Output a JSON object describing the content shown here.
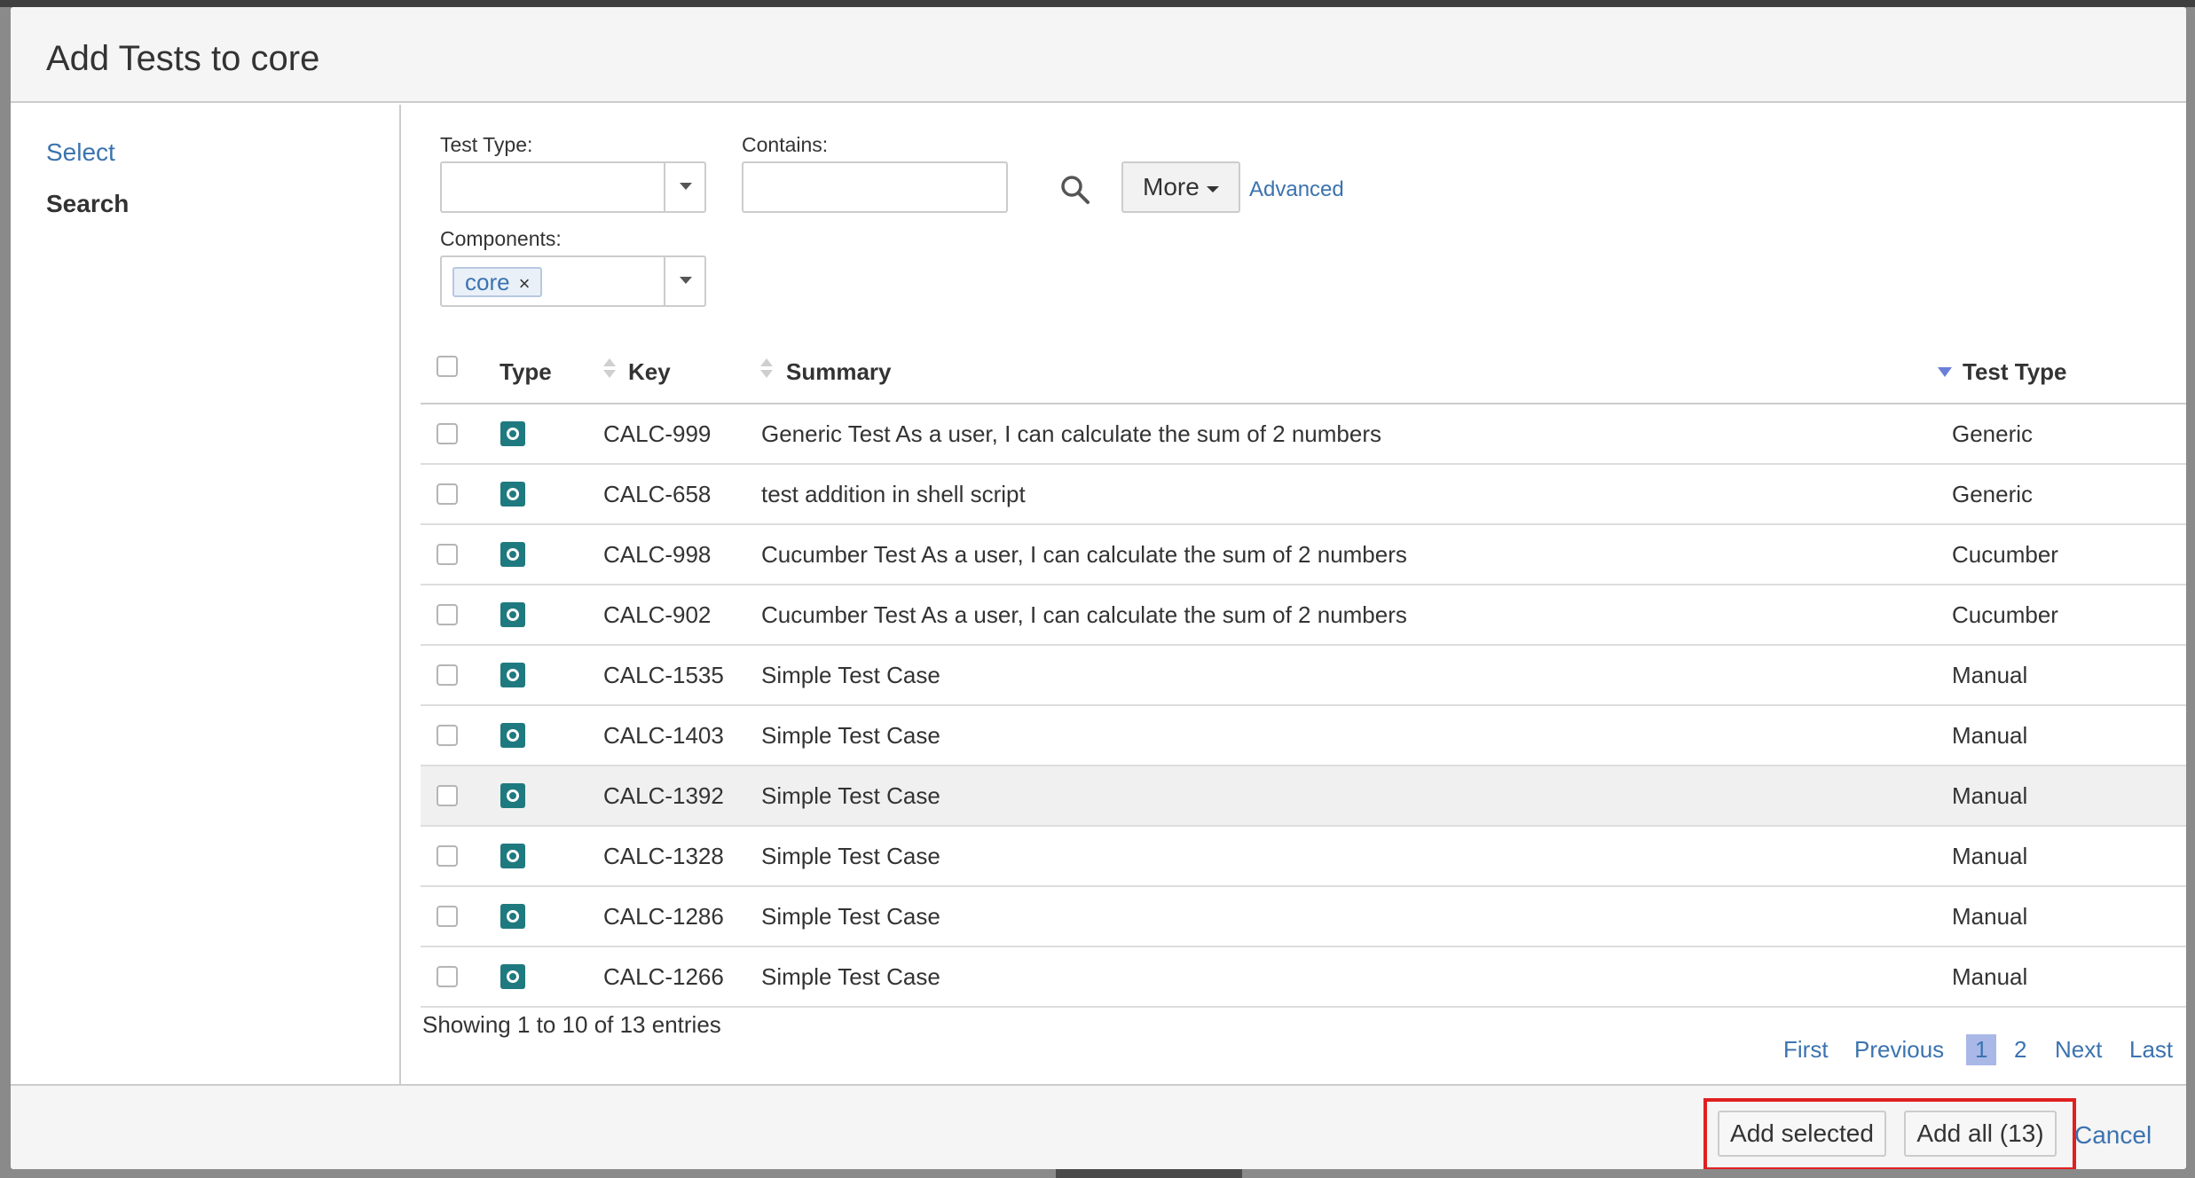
{
  "dialog": {
    "title": "Add Tests to core"
  },
  "sidebar": {
    "items": [
      {
        "label": "Select",
        "active": false
      },
      {
        "label": "Search",
        "active": true
      }
    ]
  },
  "filters": {
    "test_type_label": "Test Type:",
    "test_type_value": "",
    "contains_label": "Contains:",
    "contains_value": "",
    "components_label": "Components:",
    "component_tag": "core",
    "component_tag_remove": "×",
    "more_label": "More",
    "advanced_label": "Advanced",
    "search_icon": "search-icon"
  },
  "table": {
    "columns": [
      "Type",
      "Key",
      "Summary",
      "Test Type"
    ],
    "sorted_column": "Test Type",
    "rows": [
      {
        "key": "CALC-999",
        "summary": "Generic Test As a user, I can calculate the sum of 2 numbers",
        "test_type": "Generic"
      },
      {
        "key": "CALC-658",
        "summary": "test addition in shell script",
        "test_type": "Generic"
      },
      {
        "key": "CALC-998",
        "summary": "Cucumber Test As a user, I can calculate the sum of 2 numbers",
        "test_type": "Cucumber"
      },
      {
        "key": "CALC-902",
        "summary": "Cucumber Test As a user, I can calculate the sum of 2 numbers",
        "test_type": "Cucumber"
      },
      {
        "key": "CALC-1535",
        "summary": "Simple Test Case",
        "test_type": "Manual"
      },
      {
        "key": "CALC-1403",
        "summary": "Simple Test Case",
        "test_type": "Manual"
      },
      {
        "key": "CALC-1392",
        "summary": "Simple Test Case",
        "test_type": "Manual"
      },
      {
        "key": "CALC-1328",
        "summary": "Simple Test Case",
        "test_type": "Manual"
      },
      {
        "key": "CALC-1286",
        "summary": "Simple Test Case",
        "test_type": "Manual"
      },
      {
        "key": "CALC-1266",
        "summary": "Simple Test Case",
        "test_type": "Manual"
      }
    ]
  },
  "pagination": {
    "showing": "Showing 1 to 10 of 13 entries",
    "first": "First",
    "previous": "Previous",
    "pages": [
      "1",
      "2"
    ],
    "current_page": "1",
    "next": "Next",
    "last": "Last"
  },
  "footer": {
    "add_selected": "Add selected",
    "add_all": "Add all (13)",
    "cancel": "Cancel"
  },
  "colors": {
    "link": "#3b73af",
    "type_icon": "#1f7a80",
    "highlight_box": "#e02020",
    "current_page_bg": "#aab8e8"
  }
}
